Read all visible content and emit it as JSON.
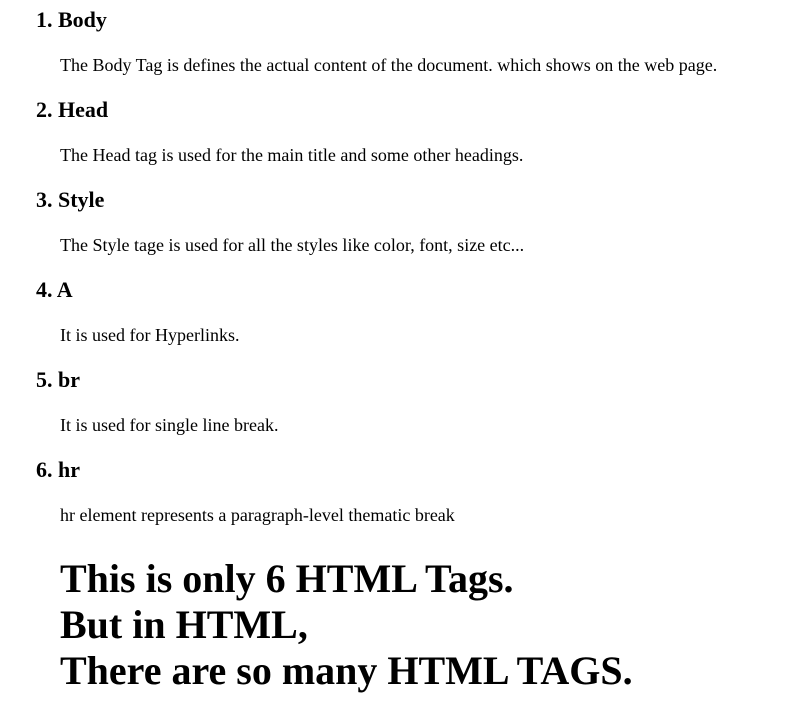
{
  "tags": [
    {
      "number": "1.",
      "name": "Body",
      "description": "The Body Tag is defines the actual content of the document. which shows on the web page."
    },
    {
      "number": "2.",
      "name": "Head",
      "description": "The Head tag is used for the main title and some other headings."
    },
    {
      "number": "3.",
      "name": "Style",
      "description": "The Style tage is used for all the styles like color, font, size etc..."
    },
    {
      "number": "4.",
      "name": "A",
      "description": "It is used for Hyperlinks."
    },
    {
      "number": "5.",
      "name": "br",
      "description": "It is used for single line break."
    },
    {
      "number": "6.",
      "name": "hr",
      "description": "hr element represents a paragraph-level thematic break"
    }
  ],
  "closing": {
    "line1": "This is only 6 HTML Tags.",
    "line2": "But in HTML,",
    "line3": "There are so many HTML TAGS."
  }
}
